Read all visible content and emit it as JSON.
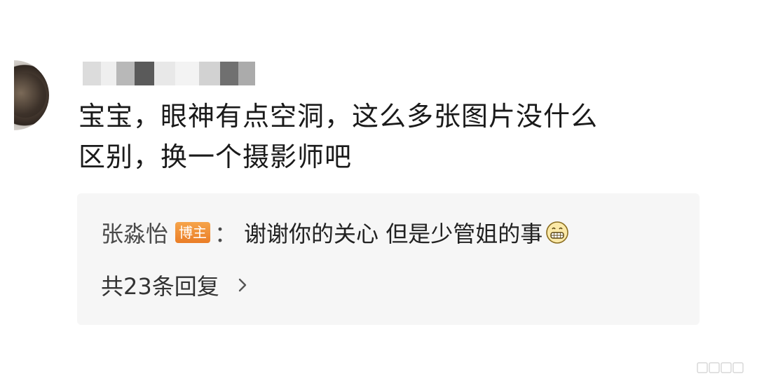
{
  "comment": {
    "username_mosaic_colors": [
      "#d9d9d9",
      "#ececec",
      "#b5b5b5",
      "#5e5e5e",
      "#e5e5e5",
      "#f2f2f2",
      "#d0d0d0",
      "#6e6e6e",
      "#a9a9a9"
    ],
    "text": "宝宝，眼神有点空洞，这么多张图片没什么\n区别，换一个摄影师吧"
  },
  "reply": {
    "author": "张淼怡",
    "badge": "博主",
    "colon": "：",
    "text": "谢谢你的关心 但是少管姐的事",
    "emoji": "grinning-face-emoji",
    "replies_count_label": "共23条回复",
    "chevron": "chevron-right-icon"
  },
  "colors": {
    "badge": "#ea7d26",
    "reply_background": "#f6f6f6",
    "text": "#1a1a1a"
  }
}
